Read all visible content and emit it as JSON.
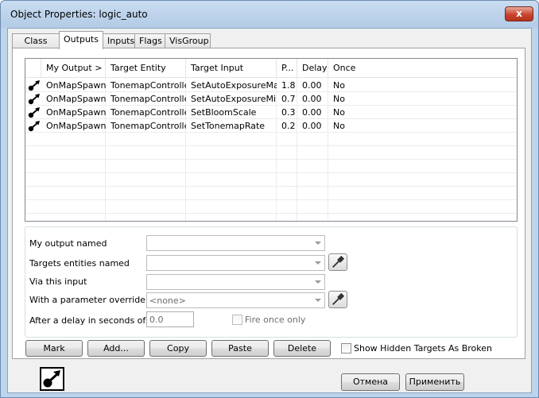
{
  "window": {
    "title": "Object Properties: logic_auto",
    "close_glyph": "x"
  },
  "tabs": [
    {
      "label": "Class Info"
    },
    {
      "label": "Outputs"
    },
    {
      "label": "Inputs"
    },
    {
      "label": "Flags"
    },
    {
      "label": "VisGroup"
    }
  ],
  "active_tab": "Outputs",
  "list": {
    "columns": [
      "My Output  >",
      "Target Entity",
      "Target Input",
      "P...",
      "Delay",
      "Once"
    ],
    "rows": [
      {
        "icon": "output-arrow-icon",
        "output": "OnMapSpawn",
        "target": "TonemapController",
        "input": "SetAutoExposureMax",
        "param": "1.8",
        "delay": "0.00",
        "once": "No"
      },
      {
        "icon": "output-arrow-icon",
        "output": "OnMapSpawn",
        "target": "TonemapController",
        "input": "SetAutoExposureMin",
        "param": "0.7",
        "delay": "0.00",
        "once": "No"
      },
      {
        "icon": "output-arrow-icon",
        "output": "OnMapSpawn",
        "target": "TonemapController",
        "input": "SetBloomScale",
        "param": "0.3",
        "delay": "0.00",
        "once": "No"
      },
      {
        "icon": "output-arrow-icon",
        "output": "OnMapSpawn",
        "target": "TonemapController",
        "input": "SetTonemapRate",
        "param": "0.2",
        "delay": "0.00",
        "once": "No"
      }
    ]
  },
  "form": {
    "output_label": "My output named",
    "targets_label": "Targets entities named",
    "input_label": "Via this input",
    "param_label": "With a parameter override of",
    "param_value": "<none>",
    "delay_label": "After a delay in seconds of",
    "delay_value": "0.0",
    "fire_once_label": "Fire once only"
  },
  "buttons": {
    "mark": "Mark",
    "add": "Add...",
    "copy": "Copy",
    "paste": "Paste",
    "delete": "Delete",
    "show_hidden_label": "Show Hidden Targets As Broken",
    "cancel": "Отмена",
    "apply": "Применить"
  },
  "colors": {
    "title_bar": "#b9d1ea",
    "close_button": "#c9452f"
  }
}
